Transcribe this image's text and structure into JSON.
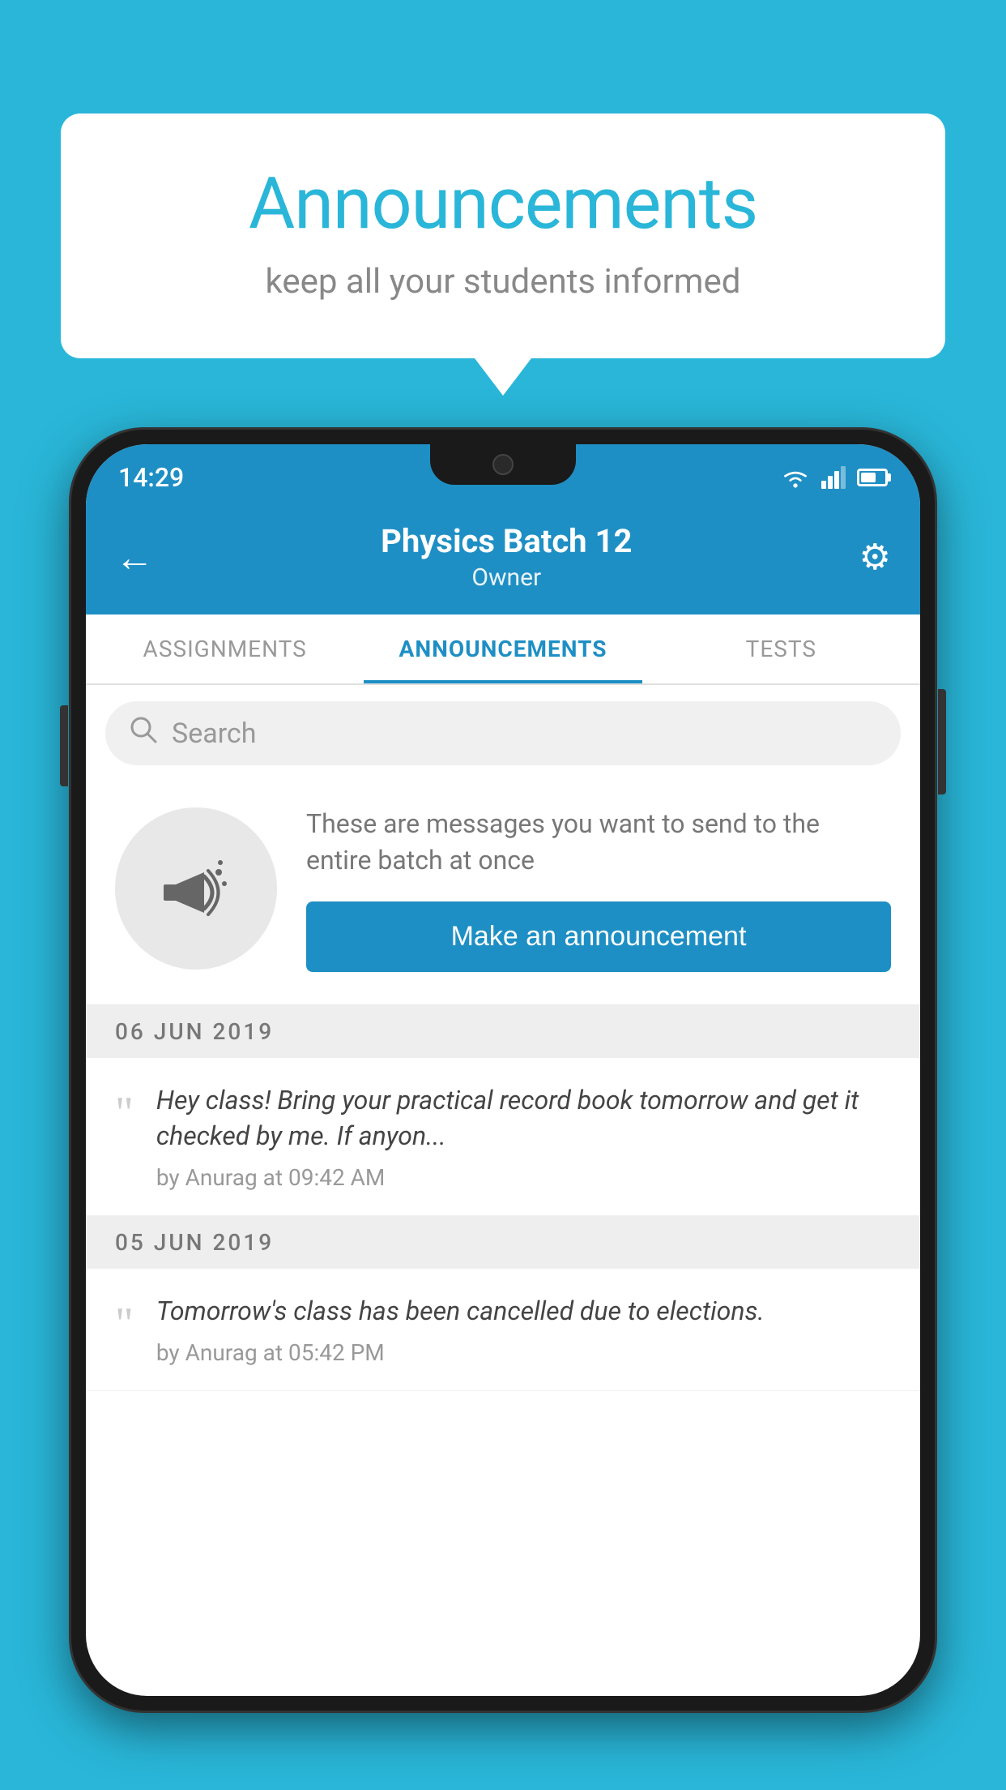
{
  "background": {
    "color": "#29b6d8"
  },
  "speech_bubble": {
    "title": "Announcements",
    "subtitle": "keep all your students informed"
  },
  "phone": {
    "status_bar": {
      "time": "14:29"
    },
    "header": {
      "title": "Physics Batch 12",
      "subtitle": "Owner",
      "back_label": "←",
      "settings_label": "⚙"
    },
    "tabs": [
      {
        "label": "ASSIGNMENTS",
        "active": false
      },
      {
        "label": "ANNOUNCEMENTS",
        "active": true
      },
      {
        "label": "TESTS",
        "active": false
      }
    ],
    "search": {
      "placeholder": "Search"
    },
    "promo": {
      "description": "These are messages you want to send to the entire batch at once",
      "button_label": "Make an announcement"
    },
    "announcements": [
      {
        "date": "06  JUN  2019",
        "text": "Hey class! Bring your practical record book tomorrow and get it checked by me. If anyon...",
        "meta": "by Anurag at 09:42 AM"
      },
      {
        "date": "05  JUN  2019",
        "text": "Tomorrow's class has been cancelled due to elections.",
        "meta": "by Anurag at 05:42 PM"
      }
    ]
  }
}
